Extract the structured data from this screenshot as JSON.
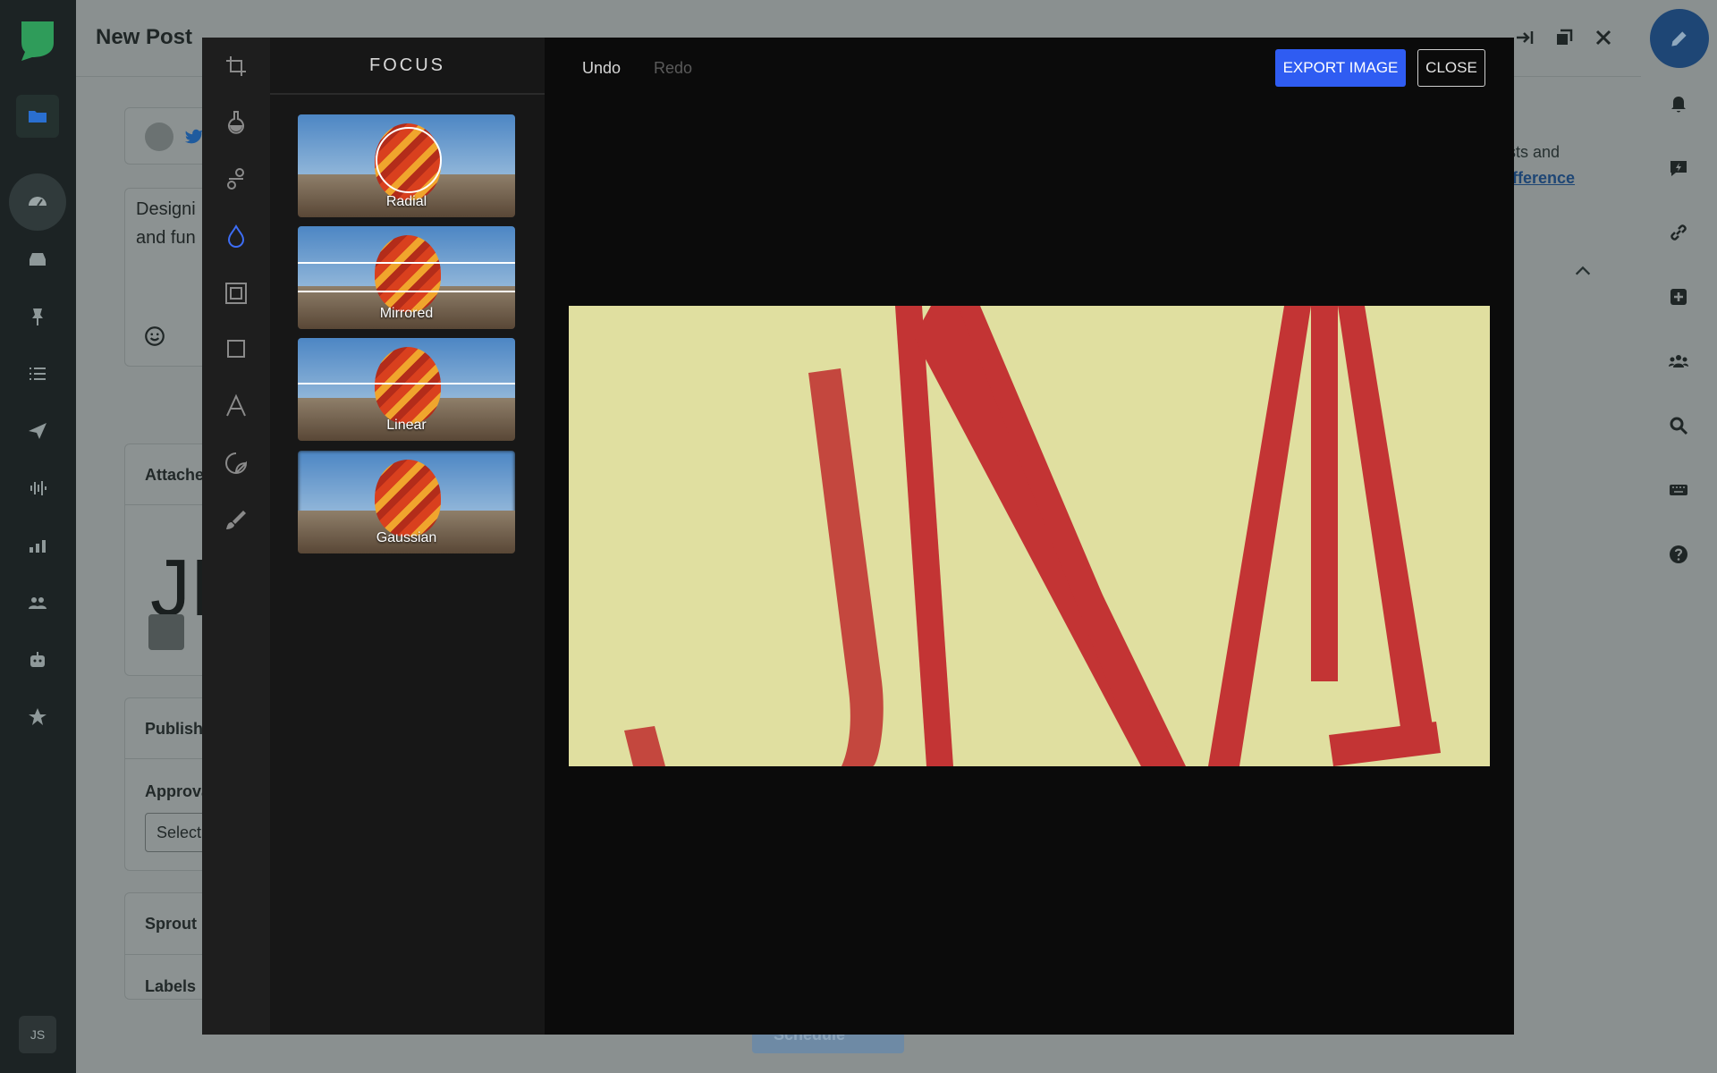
{
  "composer": {
    "title": "New Post",
    "body_text": [
      "Designi",
      "and fun"
    ],
    "right_text": "sts and",
    "right_link": "ifference",
    "sections": {
      "attached": "Attache",
      "publishing": "Publishi",
      "approval": "Approva",
      "select": "Select",
      "sprout": "Sprout",
      "labels": "Labels"
    },
    "schedule_label": "Schedule",
    "attached_preview": "JM"
  },
  "leftnav": {
    "initials": "JS",
    "items": [
      "folder-icon",
      "dashboard-icon",
      "inbox-icon",
      "pin-icon",
      "list-icon",
      "send-icon",
      "listening-icon",
      "reports-icon",
      "people-icon",
      "bot-icon",
      "star-icon"
    ]
  },
  "rightrail": {
    "items": [
      "compose-icon",
      "bell-icon",
      "activity-icon",
      "link-icon",
      "plus-icon",
      "team-icon",
      "search-icon",
      "keyboard-icon",
      "help-icon"
    ]
  },
  "editor": {
    "panel_title": "FOCUS",
    "undo_label": "Undo",
    "redo_label": "Redo",
    "export_label": "EXPORT IMAGE",
    "close_label": "CLOSE",
    "focus_options": [
      {
        "label": "Radial"
      },
      {
        "label": "Mirrored"
      },
      {
        "label": "Linear"
      },
      {
        "label": "Gaussian"
      }
    ],
    "tools": [
      "crop-icon",
      "filter-icon",
      "adjust-icon",
      "focus-icon",
      "frame-icon",
      "shape-icon",
      "text-icon",
      "sticker-icon",
      "brush-icon"
    ],
    "active_tool": "focus-icon",
    "canvas": {
      "background": "#e0dfa0",
      "letters_color": "#c23232"
    }
  },
  "colors": {
    "accent": "#2f5cf2",
    "compose": "#1e4675"
  }
}
